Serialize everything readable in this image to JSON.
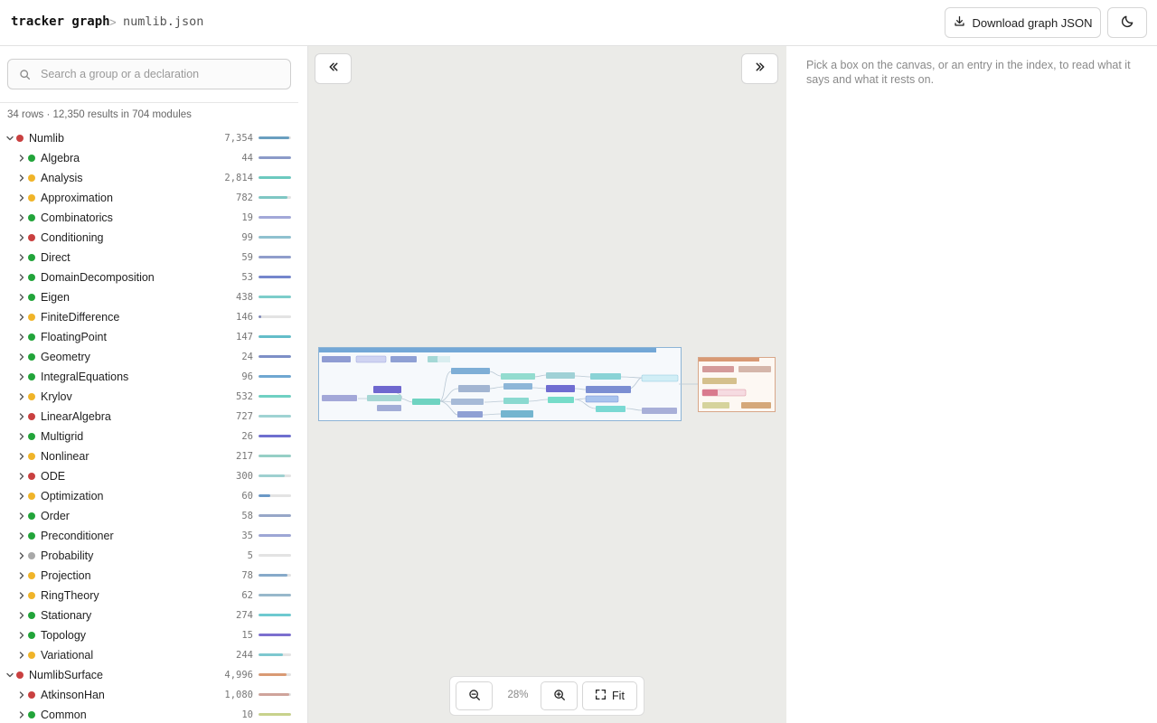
{
  "header": {
    "brand": "tracker graph",
    "separator": ">",
    "file": "numlib.json",
    "download_label": "Download graph JSON",
    "download_icon": "download-icon",
    "theme_icon": "moon-icon"
  },
  "sidebar": {
    "search_placeholder": "Search a group or a declaration",
    "summary": "34 rows · 12,350 results in 704 modules",
    "rows": [
      {
        "label": "Numlib",
        "count": "7,354",
        "status": "red",
        "level": 0,
        "expanded": true,
        "fill": 0.95,
        "color": "#6a9fc0"
      },
      {
        "label": "Algebra",
        "count": "44",
        "status": "green",
        "level": 1,
        "expanded": false,
        "fill": 1.0,
        "color": "#8b9ac8"
      },
      {
        "label": "Analysis",
        "count": "2,814",
        "status": "yellow",
        "level": 1,
        "expanded": false,
        "fill": 1.0,
        "color": "#6cc9bf"
      },
      {
        "label": "Approximation",
        "count": "782",
        "status": "yellow",
        "level": 1,
        "expanded": false,
        "fill": 0.9,
        "color": "#7fc7c4"
      },
      {
        "label": "Combinatorics",
        "count": "19",
        "status": "green",
        "level": 1,
        "expanded": false,
        "fill": 1.0,
        "color": "#a2a8d8"
      },
      {
        "label": "Conditioning",
        "count": "99",
        "status": "red",
        "level": 1,
        "expanded": false,
        "fill": 1.0,
        "color": "#8fc1cf"
      },
      {
        "label": "Direct",
        "count": "59",
        "status": "green",
        "level": 1,
        "expanded": false,
        "fill": 1.0,
        "color": "#8f9dcb"
      },
      {
        "label": "DomainDecomposition",
        "count": "53",
        "status": "green",
        "level": 1,
        "expanded": false,
        "fill": 1.0,
        "color": "#7486cc"
      },
      {
        "label": "Eigen",
        "count": "438",
        "status": "green",
        "level": 1,
        "expanded": false,
        "fill": 1.0,
        "color": "#7ccdca"
      },
      {
        "label": "FiniteDifference",
        "count": "146",
        "status": "yellow",
        "level": 1,
        "expanded": false,
        "fill": 0.08,
        "color": "#7d87b8"
      },
      {
        "label": "FloatingPoint",
        "count": "147",
        "status": "green",
        "level": 1,
        "expanded": false,
        "fill": 1.0,
        "color": "#63bdc9"
      },
      {
        "label": "Geometry",
        "count": "24",
        "status": "green",
        "level": 1,
        "expanded": false,
        "fill": 1.0,
        "color": "#7d8fc7"
      },
      {
        "label": "IntegralEquations",
        "count": "96",
        "status": "green",
        "level": 1,
        "expanded": false,
        "fill": 1.0,
        "color": "#6fa7d1"
      },
      {
        "label": "Krylov",
        "count": "532",
        "status": "yellow",
        "level": 1,
        "expanded": false,
        "fill": 1.0,
        "color": "#6fd0c3"
      },
      {
        "label": "LinearAlgebra",
        "count": "727",
        "status": "red",
        "level": 1,
        "expanded": false,
        "fill": 1.0,
        "color": "#9fd3d3"
      },
      {
        "label": "Multigrid",
        "count": "26",
        "status": "green",
        "level": 1,
        "expanded": false,
        "fill": 1.0,
        "color": "#6e6fcf"
      },
      {
        "label": "Nonlinear",
        "count": "217",
        "status": "yellow",
        "level": 1,
        "expanded": false,
        "fill": 1.0,
        "color": "#96cfc6"
      },
      {
        "label": "ODE",
        "count": "300",
        "status": "red",
        "level": 1,
        "expanded": false,
        "fill": 0.8,
        "color": "#9ed0d0"
      },
      {
        "label": "Optimization",
        "count": "60",
        "status": "yellow",
        "level": 1,
        "expanded": false,
        "fill": 0.35,
        "color": "#6a98c6"
      },
      {
        "label": "Order",
        "count": "58",
        "status": "green",
        "level": 1,
        "expanded": false,
        "fill": 1.0,
        "color": "#97a7c8"
      },
      {
        "label": "Preconditioner",
        "count": "35",
        "status": "green",
        "level": 1,
        "expanded": false,
        "fill": 1.0,
        "color": "#9da6d5"
      },
      {
        "label": "Probability",
        "count": "5",
        "status": "gray",
        "level": 1,
        "expanded": false,
        "fill": 0.0,
        "color": "#d0d0d0"
      },
      {
        "label": "Projection",
        "count": "78",
        "status": "yellow",
        "level": 1,
        "expanded": false,
        "fill": 0.9,
        "color": "#86a9c9"
      },
      {
        "label": "RingTheory",
        "count": "62",
        "status": "yellow",
        "level": 1,
        "expanded": false,
        "fill": 1.0,
        "color": "#98b8cb"
      },
      {
        "label": "Stationary",
        "count": "274",
        "status": "green",
        "level": 1,
        "expanded": false,
        "fill": 1.0,
        "color": "#6ecad0"
      },
      {
        "label": "Topology",
        "count": "15",
        "status": "green",
        "level": 1,
        "expanded": false,
        "fill": 1.0,
        "color": "#7b6fcf"
      },
      {
        "label": "Variational",
        "count": "244",
        "status": "yellow",
        "level": 1,
        "expanded": false,
        "fill": 0.75,
        "color": "#7ec8cf"
      },
      {
        "label": "NumlibSurface",
        "count": "4,996",
        "status": "red",
        "level": 0,
        "expanded": true,
        "fill": 0.85,
        "color": "#d99a74"
      },
      {
        "label": "AtkinsonHan",
        "count": "1,080",
        "status": "red",
        "level": 1,
        "expanded": false,
        "fill": 0.95,
        "color": "#cfa49b"
      },
      {
        "label": "Common",
        "count": "10",
        "status": "green",
        "level": 1,
        "expanded": false,
        "fill": 1.0,
        "color": "#c8d28c"
      }
    ]
  },
  "canvas": {
    "zoom_level": "28%",
    "fit_label": "Fit",
    "collapse_left_icon": "double-chevron-left-icon",
    "collapse_right_icon": "double-chevron-right-icon"
  },
  "detail": {
    "hint": "Pick a box on the canvas, or an entry in the index, to read what it says and what it rests on."
  },
  "status_colors": {
    "red": "#c94040",
    "green": "#22a43a",
    "yellow": "#f0b429",
    "gray": "#a8a8a8"
  }
}
